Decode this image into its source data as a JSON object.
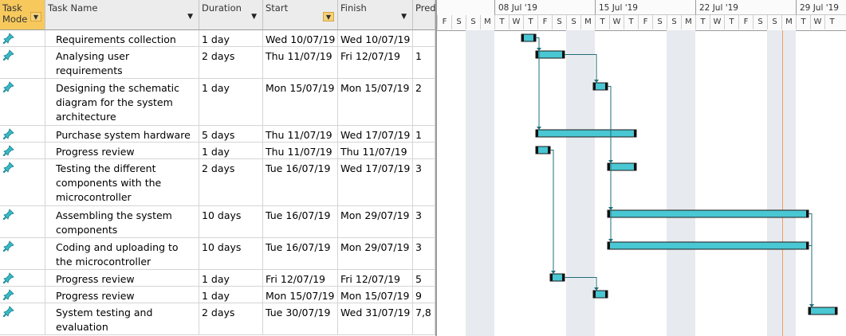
{
  "columns": {
    "mode": "Task Mode",
    "name": "Task Name",
    "duration": "Duration",
    "start": "Start",
    "finish": "Finish",
    "pred": "Pred"
  },
  "timescale": {
    "weeks": [
      "08 Jul '19",
      "15 Jul '19",
      "22 Jul '19",
      "29 Jul '19"
    ],
    "days": [
      "F",
      "S",
      "S",
      "M",
      "T",
      "W",
      "T",
      "F",
      "S",
      "S",
      "M",
      "T",
      "W",
      "T",
      "F",
      "S",
      "S",
      "M",
      "T",
      "W",
      "T",
      "F",
      "S",
      "S",
      "M",
      "T",
      "W",
      "T"
    ]
  },
  "colors": {
    "bar_fill": "#49c7d3",
    "link_line": "#1f6f78",
    "header_mode": "#f7c95d",
    "today_line": "#f2a061",
    "weekend_shade": "#e7eaef"
  },
  "icons": {
    "task_mode": "pin-icon"
  },
  "tasks": [
    {
      "name": "Requirements collection",
      "duration": "1 day",
      "start": "Wed 10/07/19",
      "finish": "Wed 10/07/19",
      "pred": ""
    },
    {
      "name": "Analysing user requirements",
      "duration": "2 days",
      "start": "Thu 11/07/19",
      "finish": "Fri 12/07/19",
      "pred": "1"
    },
    {
      "name": "Designing the schematic diagram for the system architecture",
      "duration": "1 day",
      "start": "Mon 15/07/19",
      "finish": "Mon 15/07/19",
      "pred": "2"
    },
    {
      "name": "Purchase system hardware",
      "duration": "5 days",
      "start": "Thu 11/07/19",
      "finish": "Wed 17/07/19",
      "pred": "1"
    },
    {
      "name": "Progress review",
      "duration": "1 day",
      "start": "Thu 11/07/19",
      "finish": "Thu 11/07/19",
      "pred": ""
    },
    {
      "name": "Testing the different components with the microcontroller",
      "duration": "2 days",
      "start": "Tue 16/07/19",
      "finish": "Wed 17/07/19",
      "pred": "3"
    },
    {
      "name": "Assembling the system components",
      "duration": "10 days",
      "start": "Tue 16/07/19",
      "finish": "Mon 29/07/19",
      "pred": "3"
    },
    {
      "name": "Coding and uploading to the microcontroller",
      "duration": "10 days",
      "start": "Tue 16/07/19",
      "finish": "Mon 29/07/19",
      "pred": "3"
    },
    {
      "name": "Progress review",
      "duration": "1 day",
      "start": "Fri 12/07/19",
      "finish": "Fri 12/07/19",
      "pred": "5"
    },
    {
      "name": "Progress review",
      "duration": "1 day",
      "start": "Mon 15/07/19",
      "finish": "Mon 15/07/19",
      "pred": "9"
    },
    {
      "name": "System testing and evaluation",
      "duration": "2 days",
      "start": "Tue 30/07/19",
      "finish": "Wed 31/07/19",
      "pred": "7,8"
    }
  ]
}
